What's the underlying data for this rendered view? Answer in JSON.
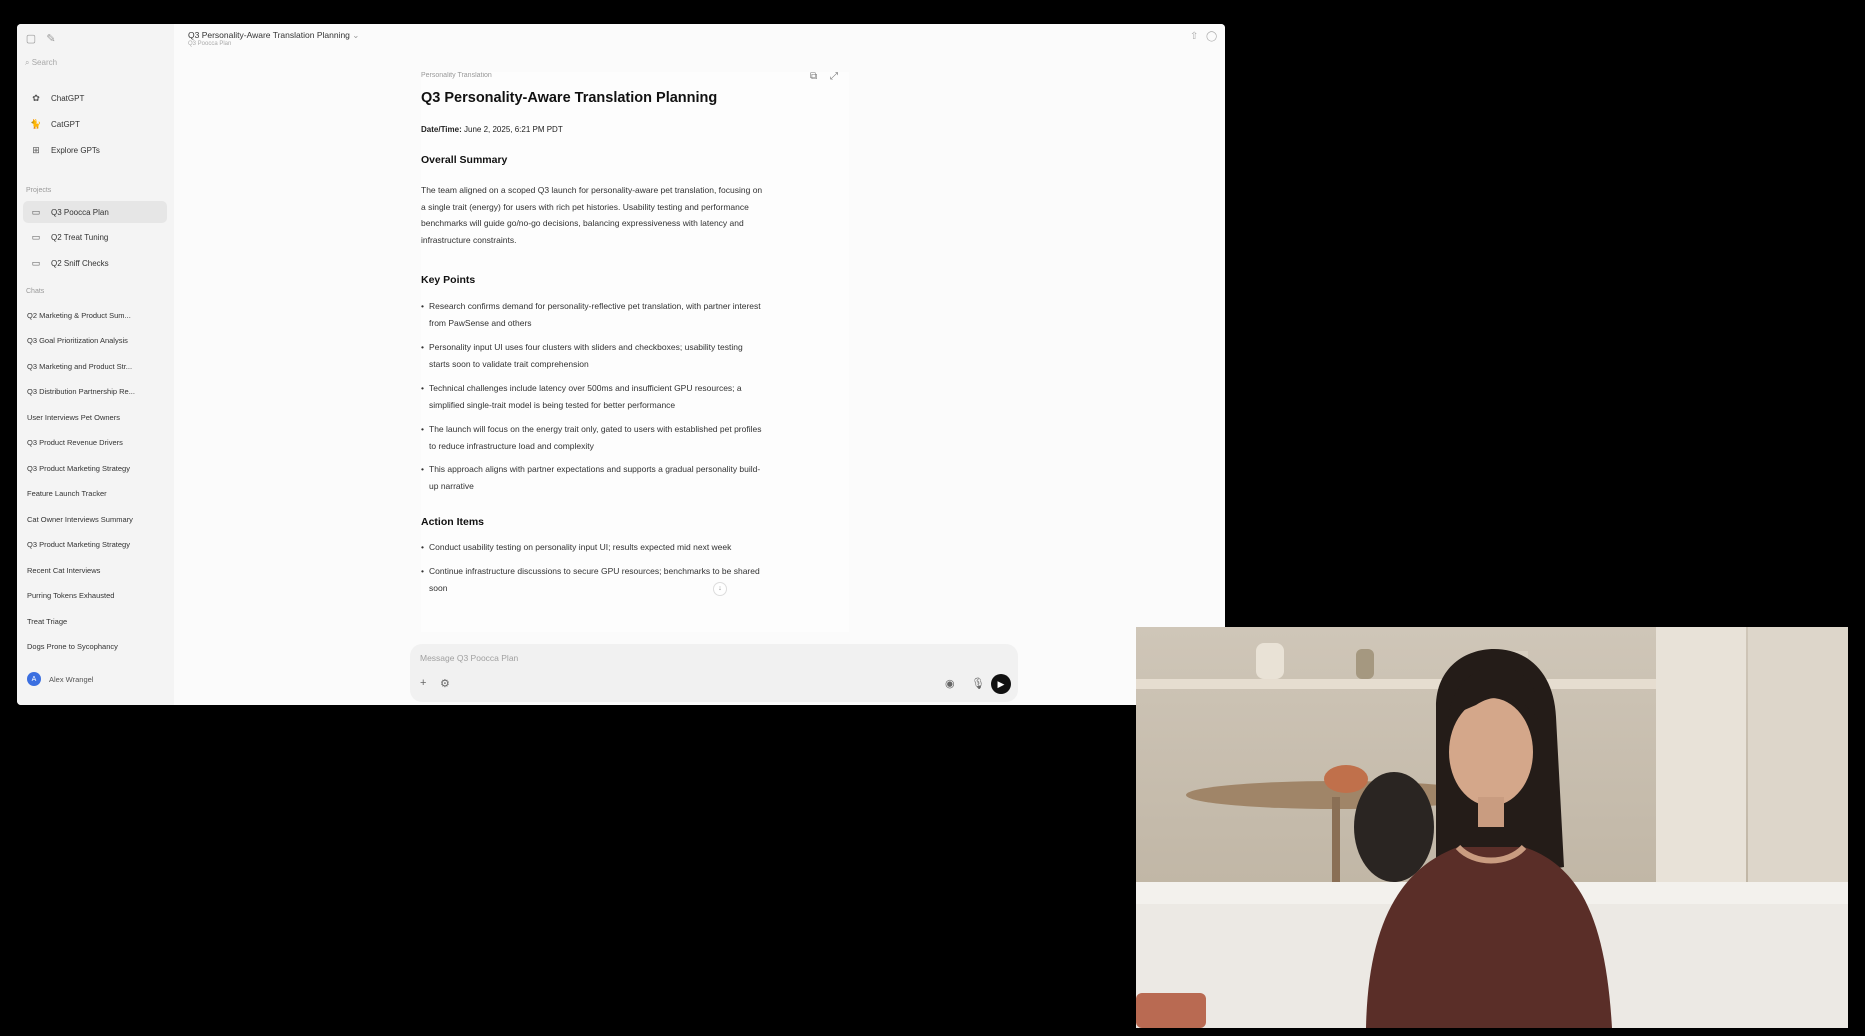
{
  "sidebar": {
    "search_placeholder": "Search",
    "nav": [
      {
        "label": "ChatGPT",
        "icon": "chatgpt-logo-icon"
      },
      {
        "label": "CatGPT",
        "icon": "cat-icon"
      },
      {
        "label": "Explore GPTs",
        "icon": "grid-icon"
      }
    ],
    "projects_heading": "Projects",
    "projects": [
      {
        "label": "Q3 Poocca Plan",
        "active": true
      },
      {
        "label": "Q2 Treat Tuning",
        "active": false
      },
      {
        "label": "Q2 Sniff Checks",
        "active": false
      }
    ],
    "chats_heading": "Chats",
    "chats": [
      "Q2 Marketing & Product Sum...",
      "Q3 Goal Prioritization Analysis",
      "Q3 Marketing and Product Str...",
      "Q3 Distribution Partnership Re...",
      "User Interviews Pet Owners",
      "Q3 Product Revenue Drivers",
      "Q3 Product Marketing Strategy",
      "Feature Launch Tracker",
      "Cat Owner Interviews Summary",
      "Q3 Product Marketing Strategy",
      "Recent Cat Interviews",
      "Purring Tokens Exhausted",
      "Treat Triage",
      "Dogs Prone to Sycophancy"
    ],
    "user_name": "Alex Wrangel",
    "user_initial": "A"
  },
  "topbar": {
    "title": "Q3 Personality-Aware Translation Planning",
    "subtitle": "Q3 Poocca Plan"
  },
  "canvas": {
    "label": "Personality Translation",
    "title": "Q3 Personality-Aware Translation Planning",
    "datetime_label": "Date/Time:",
    "datetime_value": "June 2, 2025, 6:21 PM PDT",
    "summary_heading": "Overall Summary",
    "summary_lines": [
      "The team aligned on a scoped Q3 launch for personality-aware pet translation, focusing on",
      "a single trait (energy) for users with rich pet histories. Usability testing and performance",
      "benchmarks will guide go/no-go decisions, balancing expressiveness with latency and",
      "infrastructure constraints."
    ],
    "key_points_heading": "Key Points",
    "key_points": [
      [
        "Research confirms demand for personality-reflective pet translation, with partner interest",
        "from PawSense and others"
      ],
      [
        "Personality input UI uses four clusters with sliders and checkboxes; usability testing",
        "starts soon to validate trait comprehension"
      ],
      [
        "Technical challenges include latency over 500ms and insufficient GPU resources; a",
        "simplified single-trait model is being tested for better performance"
      ],
      [
        "The launch will focus on the energy trait only, gated to users with established pet profiles",
        "to reduce infrastructure load and complexity"
      ],
      [
        "This approach aligns with partner expectations and supports a gradual personality build-",
        "up narrative"
      ]
    ],
    "action_items_heading": "Action Items",
    "action_items": [
      [
        "Conduct usability testing on personality input UI; results expected mid next week"
      ],
      [
        "Continue infrastructure discussions to secure GPU resources; benchmarks to be shared",
        "soon"
      ]
    ]
  },
  "composer": {
    "placeholder": "Message Q3 Poocca Plan"
  }
}
